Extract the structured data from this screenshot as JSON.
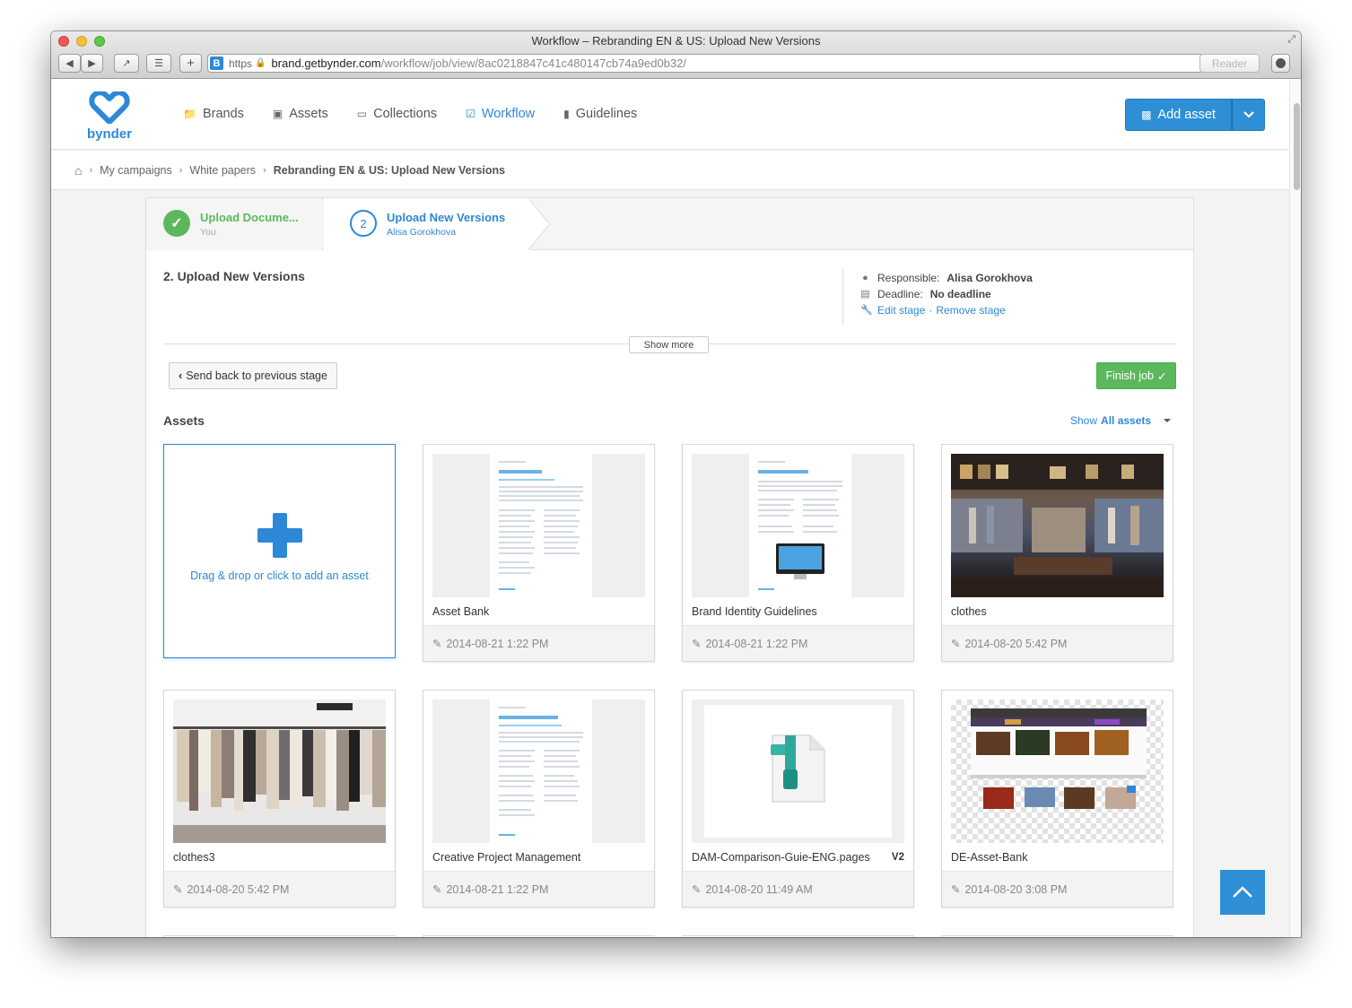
{
  "window": {
    "title": "Workflow – Rebranding EN & US: Upload New Versions",
    "url_scheme": "https",
    "url_host": "brand.getbynder.com",
    "url_path": "/workflow/job/view/8ac0218847c41c480147cb74a9ed0b32/",
    "reader_label": "Reader"
  },
  "header": {
    "logo_text": "bynder",
    "nav": [
      {
        "label": "Brands",
        "icon": "folder-icon"
      },
      {
        "label": "Assets",
        "icon": "image-icon"
      },
      {
        "label": "Collections",
        "icon": "inbox-icon"
      },
      {
        "label": "Workflow",
        "icon": "check-square-icon",
        "active": true
      },
      {
        "label": "Guidelines",
        "icon": "book-icon"
      }
    ],
    "add_asset_label": "Add asset"
  },
  "breadcrumb": {
    "items": [
      "My campaigns",
      "White papers"
    ],
    "current": "Rebranding EN & US: Upload New Versions"
  },
  "stages": [
    {
      "title": "Upload Docume...",
      "sub": "You",
      "status": "done"
    },
    {
      "title": "Upload New Versions",
      "sub": "Alisa Gorokhova",
      "number": "2",
      "status": "active"
    }
  ],
  "stage_detail": {
    "title": "2. Upload New Versions",
    "responsible_label": "Responsible:",
    "responsible_value": "Alisa Gorokhova",
    "deadline_label": "Deadline:",
    "deadline_value": "No deadline",
    "edit_link": "Edit stage",
    "separator": "·",
    "remove_link": "Remove stage",
    "show_more": "Show more"
  },
  "actions": {
    "send_back": "Send back to previous stage",
    "finish": "Finish job"
  },
  "assets_section": {
    "title": "Assets",
    "show_prefix": "Show",
    "show_bold": "All assets",
    "drop_text": "Drag & drop or click to add an asset"
  },
  "assets": [
    {
      "name": "Asset Bank",
      "date": "2014-08-21 1:22 PM",
      "kind": "doc",
      "doc_title": "Media Asset Bank"
    },
    {
      "name": "Brand Identity Guidelines",
      "date": "2014-08-21 1:22 PM",
      "kind": "doc",
      "doc_title": "Brand Identity Guidelines"
    },
    {
      "name": "clothes",
      "date": "2014-08-20 5:42 PM",
      "kind": "photo"
    },
    {
      "name": "clothes3",
      "date": "2014-08-20 5:42 PM",
      "kind": "photo"
    },
    {
      "name": "Creative Project Management",
      "date": "2014-08-21 1:22 PM",
      "kind": "doc",
      "doc_title": "Creative Project Management"
    },
    {
      "name": "DAM-Comparison-Guie-ENG.pages",
      "date": "2014-08-20 11:49 AM",
      "kind": "zip",
      "version": "V2"
    },
    {
      "name": "DE-Asset-Bank",
      "date": "2014-08-20 3:08 PM",
      "kind": "screenshot"
    }
  ],
  "colors": {
    "accent": "#2e88d8",
    "success": "#5cb85c"
  }
}
